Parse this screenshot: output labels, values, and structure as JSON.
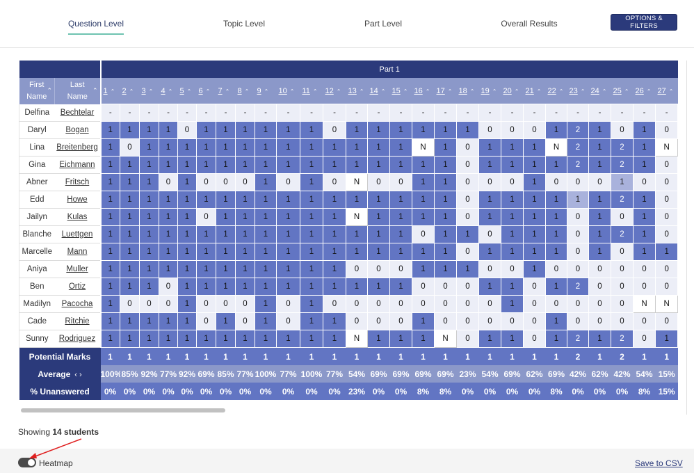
{
  "tabs": [
    {
      "label": "Question Level",
      "active": true
    },
    {
      "label": "Topic Level",
      "active": false
    },
    {
      "label": "Part Level",
      "active": false
    },
    {
      "label": "Overall Results",
      "active": false
    }
  ],
  "options_button": "OPTIONS & FILTERS",
  "table": {
    "part_label": "Part 1",
    "first_name_header": "First Name",
    "last_name_header": "Last Name",
    "sort_icon": "⌃",
    "questions": [
      "1",
      "2",
      "3",
      "4",
      "5",
      "6",
      "7",
      "8",
      "9",
      "10",
      "11",
      "12",
      "13",
      "14",
      "15",
      "16",
      "17",
      "18",
      "19",
      "20",
      "21",
      "22",
      "23",
      "24",
      "25",
      "26",
      "27"
    ],
    "students": [
      {
        "first": "Delfina",
        "last": "Bechtelar",
        "cells": [
          "-",
          "-",
          "-",
          "-",
          "-",
          "-",
          "-",
          "-",
          "-",
          "-",
          "-",
          "-",
          "-",
          "-",
          "-",
          "-",
          "-",
          "-",
          "-",
          "-",
          "-",
          "-",
          "-",
          "-",
          "-",
          "-",
          "-"
        ]
      },
      {
        "first": "Daryl",
        "last": "Bogan",
        "cells": [
          "1",
          "1",
          "1",
          "1",
          "0",
          "1",
          "1",
          "1",
          "1",
          "1",
          "1",
          "0",
          "1",
          "1",
          "1",
          "1",
          "1",
          "1",
          "0",
          "0",
          "0",
          "1",
          "2",
          "1",
          "0",
          "1",
          "0"
        ]
      },
      {
        "first": "Lina",
        "last": "Breitenberg",
        "cells": [
          "1",
          "0",
          "1",
          "1",
          "1",
          "1",
          "1",
          "1",
          "1",
          "1",
          "1",
          "1",
          "1",
          "1",
          "1",
          "N",
          "1",
          "0",
          "1",
          "1",
          "1",
          "N",
          "2",
          "1",
          "2",
          "1",
          "N"
        ]
      },
      {
        "first": "Gina",
        "last": "Eichmann",
        "cells": [
          "1",
          "1",
          "1",
          "1",
          "1",
          "1",
          "1",
          "1",
          "1",
          "1",
          "1",
          "1",
          "1",
          "1",
          "1",
          "1",
          "1",
          "0",
          "1",
          "1",
          "1",
          "1",
          "2",
          "1",
          "2",
          "1",
          "0"
        ]
      },
      {
        "first": "Abner",
        "last": "Fritsch",
        "cells": [
          "1",
          "1",
          "1",
          "0",
          "1",
          "0",
          "0",
          "0",
          "1",
          "0",
          "1",
          "0",
          "N",
          "0",
          "0",
          "1",
          "1",
          "0",
          "0",
          "0",
          "1",
          "0",
          "0",
          "0",
          "1",
          "0",
          "0"
        ]
      },
      {
        "first": "Edd",
        "last": "Howe",
        "cells": [
          "1",
          "1",
          "1",
          "1",
          "1",
          "1",
          "1",
          "1",
          "1",
          "1",
          "1",
          "1",
          "1",
          "1",
          "1",
          "1",
          "1",
          "0",
          "1",
          "1",
          "1",
          "1",
          "1",
          "1",
          "2",
          "1",
          "0"
        ]
      },
      {
        "first": "Jailyn",
        "last": "Kulas",
        "cells": [
          "1",
          "1",
          "1",
          "1",
          "1",
          "0",
          "1",
          "1",
          "1",
          "1",
          "1",
          "1",
          "N",
          "1",
          "1",
          "1",
          "1",
          "0",
          "1",
          "1",
          "1",
          "1",
          "0",
          "1",
          "0",
          "1",
          "0"
        ]
      },
      {
        "first": "Blanche",
        "last": "Luettgen",
        "cells": [
          "1",
          "1",
          "1",
          "1",
          "1",
          "1",
          "1",
          "1",
          "1",
          "1",
          "1",
          "1",
          "1",
          "1",
          "1",
          "0",
          "1",
          "1",
          "0",
          "1",
          "1",
          "1",
          "0",
          "1",
          "2",
          "1",
          "0"
        ]
      },
      {
        "first": "Marcelle",
        "last": "Mann",
        "cells": [
          "1",
          "1",
          "1",
          "1",
          "1",
          "1",
          "1",
          "1",
          "1",
          "1",
          "1",
          "1",
          "1",
          "1",
          "1",
          "1",
          "1",
          "0",
          "1",
          "1",
          "1",
          "1",
          "0",
          "1",
          "0",
          "1",
          "1"
        ]
      },
      {
        "first": "Aniya",
        "last": "Muller",
        "cells": [
          "1",
          "1",
          "1",
          "1",
          "1",
          "1",
          "1",
          "1",
          "1",
          "1",
          "1",
          "1",
          "0",
          "0",
          "0",
          "1",
          "1",
          "1",
          "0",
          "0",
          "1",
          "0",
          "0",
          "0",
          "0",
          "0",
          "0"
        ]
      },
      {
        "first": "Ben",
        "last": "Ortiz",
        "cells": [
          "1",
          "1",
          "1",
          "0",
          "1",
          "1",
          "1",
          "1",
          "1",
          "1",
          "1",
          "1",
          "1",
          "1",
          "1",
          "0",
          "0",
          "0",
          "1",
          "1",
          "0",
          "1",
          "2",
          "0",
          "0",
          "0",
          "0"
        ]
      },
      {
        "first": "Madilyn",
        "last": "Pacocha",
        "cells": [
          "1",
          "0",
          "0",
          "0",
          "1",
          "0",
          "0",
          "0",
          "1",
          "0",
          "1",
          "0",
          "0",
          "0",
          "0",
          "0",
          "0",
          "0",
          "0",
          "1",
          "0",
          "0",
          "0",
          "0",
          "0",
          "N",
          "N"
        ]
      },
      {
        "first": "Cade",
        "last": "Ritchie",
        "cells": [
          "1",
          "1",
          "1",
          "1",
          "1",
          "0",
          "1",
          "0",
          "1",
          "0",
          "1",
          "1",
          "0",
          "0",
          "0",
          "1",
          "0",
          "0",
          "0",
          "0",
          "0",
          "1",
          "0",
          "0",
          "0",
          "0",
          "0"
        ]
      },
      {
        "first": "Sunny",
        "last": "Rodriguez",
        "cells": [
          "1",
          "1",
          "1",
          "1",
          "1",
          "1",
          "1",
          "1",
          "1",
          "1",
          "1",
          "1",
          "N",
          "1",
          "1",
          "1",
          "N",
          "0",
          "1",
          "1",
          "0",
          "1",
          "2",
          "1",
          "2",
          "0",
          "1"
        ]
      }
    ],
    "potential_label": "Potential Marks",
    "potential": [
      "1",
      "1",
      "1",
      "1",
      "1",
      "1",
      "1",
      "1",
      "1",
      "1",
      "1",
      "1",
      "1",
      "1",
      "1",
      "1",
      "1",
      "1",
      "1",
      "1",
      "1",
      "1",
      "2",
      "1",
      "2",
      "1",
      "1"
    ],
    "average_label": "Average",
    "average_arrows": "‹ ›",
    "average": [
      "100%",
      "85%",
      "92%",
      "77%",
      "92%",
      "69%",
      "85%",
      "77%",
      "100%",
      "77%",
      "100%",
      "77%",
      "54%",
      "69%",
      "69%",
      "69%",
      "69%",
      "23%",
      "54%",
      "69%",
      "62%",
      "69%",
      "42%",
      "62%",
      "42%",
      "54%",
      "15%"
    ],
    "unanswered_label": "% Unanswered",
    "unanswered": [
      "0%",
      "0%",
      "0%",
      "0%",
      "0%",
      "0%",
      "0%",
      "0%",
      "0%",
      "0%",
      "0%",
      "0%",
      "23%",
      "0%",
      "0%",
      "8%",
      "8%",
      "0%",
      "0%",
      "0%",
      "0%",
      "8%",
      "0%",
      "0%",
      "0%",
      "8%",
      "15%"
    ]
  },
  "showing_prefix": "Showing ",
  "showing_count": "14 students",
  "heatmap_label": "Heatmap",
  "heatmap_on": true,
  "save_csv": "Save to CSV",
  "colors": {
    "header_dark": "#2b3a7b",
    "header_light": "#8b98c9",
    "cell_full": "#6275c3",
    "cell_zero": "#eceef7",
    "tab_underline": "#6ec3b0",
    "annotation_arrow": "#e02020"
  }
}
